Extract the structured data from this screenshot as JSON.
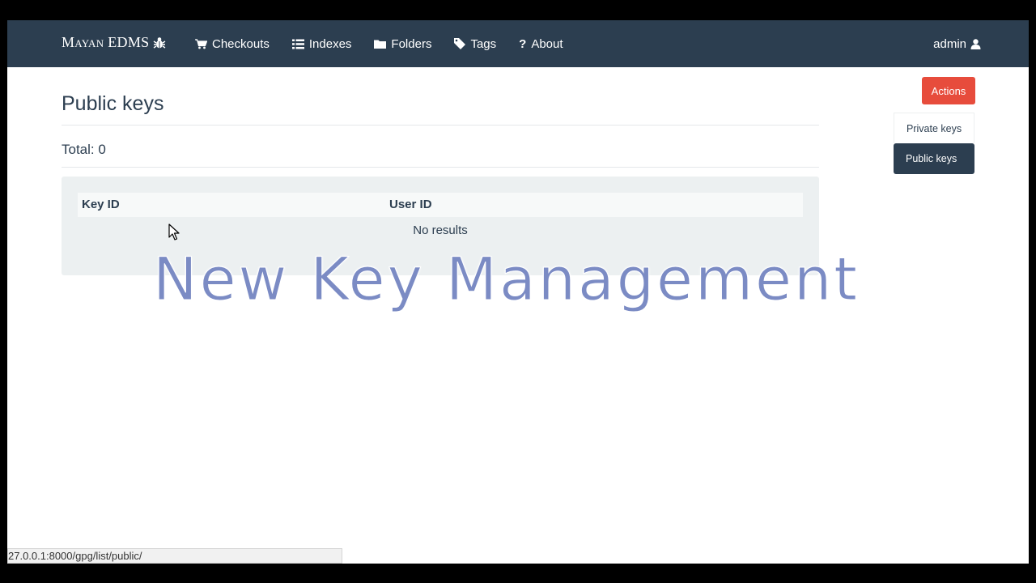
{
  "navbar": {
    "brand": "Mayan EDMS",
    "items": [
      {
        "label": "Checkouts",
        "icon": "cart-icon"
      },
      {
        "label": "Indexes",
        "icon": "list-icon"
      },
      {
        "label": "Folders",
        "icon": "folder-icon"
      },
      {
        "label": "Tags",
        "icon": "tag-icon"
      },
      {
        "label": "About",
        "icon": "question-icon"
      }
    ],
    "user": {
      "label": "admin",
      "icon": "user-icon"
    }
  },
  "main": {
    "title": "Public keys",
    "total": "Total: 0",
    "table": {
      "columns": [
        "Key ID",
        "User ID"
      ],
      "empty_text": "No results"
    }
  },
  "sidebar": {
    "actions_label": "Actions",
    "items": [
      {
        "label": "Private keys",
        "active": false
      },
      {
        "label": "Public keys",
        "active": true
      }
    ]
  },
  "overlay_caption": "New Key Management",
  "statusbar": {
    "url": "27.0.0.1:8000/gpg/list/public/"
  },
  "colors": {
    "navbar": "#2c3e50",
    "actions_button": "#e74c3c",
    "well": "#ecf0f1",
    "overlay_text": "#7b8bc4"
  }
}
